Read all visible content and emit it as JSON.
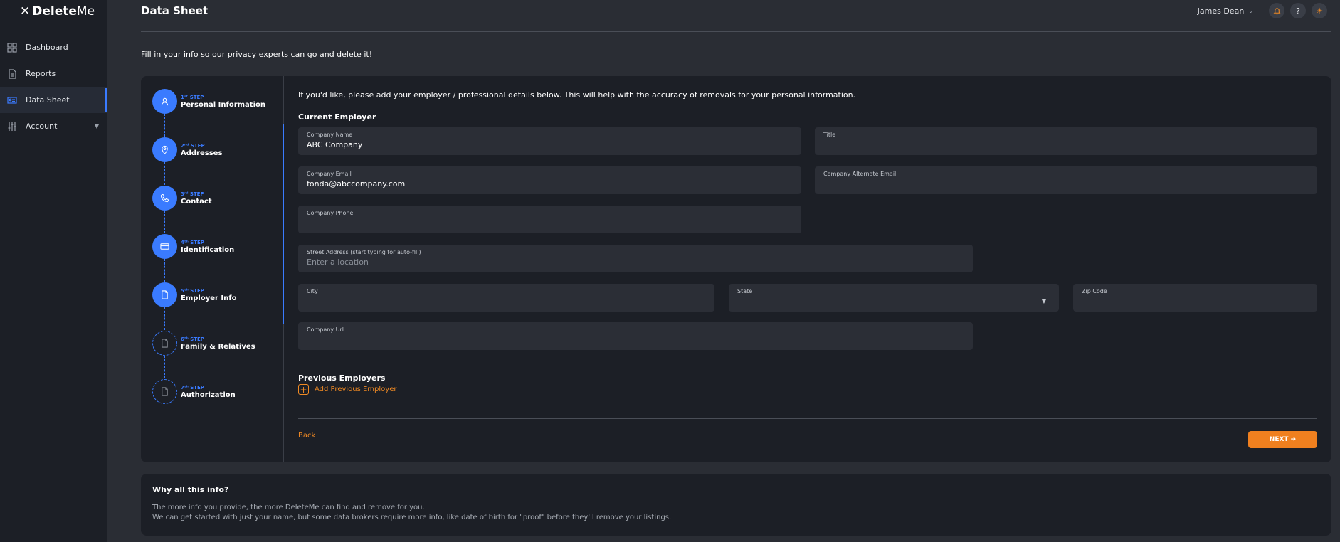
{
  "app": {
    "brand_prefix": "Delete",
    "brand_suffix": "Me"
  },
  "sidebar": {
    "items": [
      {
        "label": "Dashboard",
        "icon": "grid-icon"
      },
      {
        "label": "Reports",
        "icon": "document-icon"
      },
      {
        "label": "Data Sheet",
        "icon": "id-card-icon",
        "active": true
      },
      {
        "label": "Account",
        "icon": "sliders-icon"
      }
    ]
  },
  "header": {
    "title": "Data Sheet",
    "user_name": "James Dean",
    "intro": "Fill in your info so our privacy experts can go and delete it!"
  },
  "steps": [
    {
      "num": "1ˢᵗ STEP",
      "label": "Personal Information",
      "icon": "user-icon",
      "status": "done"
    },
    {
      "num": "2ⁿᵈ STEP",
      "label": "Addresses",
      "icon": "map-pin-icon",
      "status": "done"
    },
    {
      "num": "3ʳᵈ STEP",
      "label": "Contact",
      "icon": "phone-icon",
      "status": "done"
    },
    {
      "num": "4ᵗʰ STEP",
      "label": "Identification",
      "icon": "card-icon",
      "status": "done"
    },
    {
      "num": "5ᵗʰ STEP",
      "label": "Employer Info",
      "icon": "file-icon",
      "status": "current"
    },
    {
      "num": "6ᵗʰ STEP",
      "label": "Family & Relatives",
      "icon": "file-icon",
      "status": "pending"
    },
    {
      "num": "7ᵗʰ STEP",
      "label": "Authorization",
      "icon": "file-icon",
      "status": "pending"
    }
  ],
  "form": {
    "intro": "If you'd like, please add your employer / professional details below. This will help with the accuracy of removals for your personal information.",
    "current_employer_title": "Current Employer",
    "fields": {
      "company_name": {
        "label": "Company Name",
        "value": "ABC Company"
      },
      "title": {
        "label": "Title",
        "value": ""
      },
      "company_email": {
        "label": "Company Email",
        "value": "fonda@abccompany.com"
      },
      "company_alt_email": {
        "label": "Company Alternate Email",
        "value": ""
      },
      "company_phone": {
        "label": "Company Phone",
        "value": ""
      },
      "street_address": {
        "label": "Street Address (start typing for auto-fill)",
        "placeholder": "Enter a location"
      },
      "city": {
        "label": "City",
        "value": ""
      },
      "state": {
        "label": "State",
        "value": ""
      },
      "zip": {
        "label": "Zip Code",
        "value": ""
      },
      "company_url": {
        "label": "Company Url",
        "value": ""
      }
    },
    "previous_employers_title": "Previous Employers",
    "add_previous_label": "Add Previous Employer",
    "back_label": "Back",
    "next_label": "NEXT ➔"
  },
  "info": {
    "title": "Why all this info?",
    "line1": "The more info you provide, the more DeleteMe can find and remove for you.",
    "line2": "We can get started with just your name, but some data brokers require more info, like date of birth for \"proof\" before they'll remove your listings."
  },
  "colors": {
    "accent_blue": "#3a7bff",
    "accent_orange": "#f0801f",
    "panel": "#1c1f26",
    "background": "#2a2d34"
  }
}
